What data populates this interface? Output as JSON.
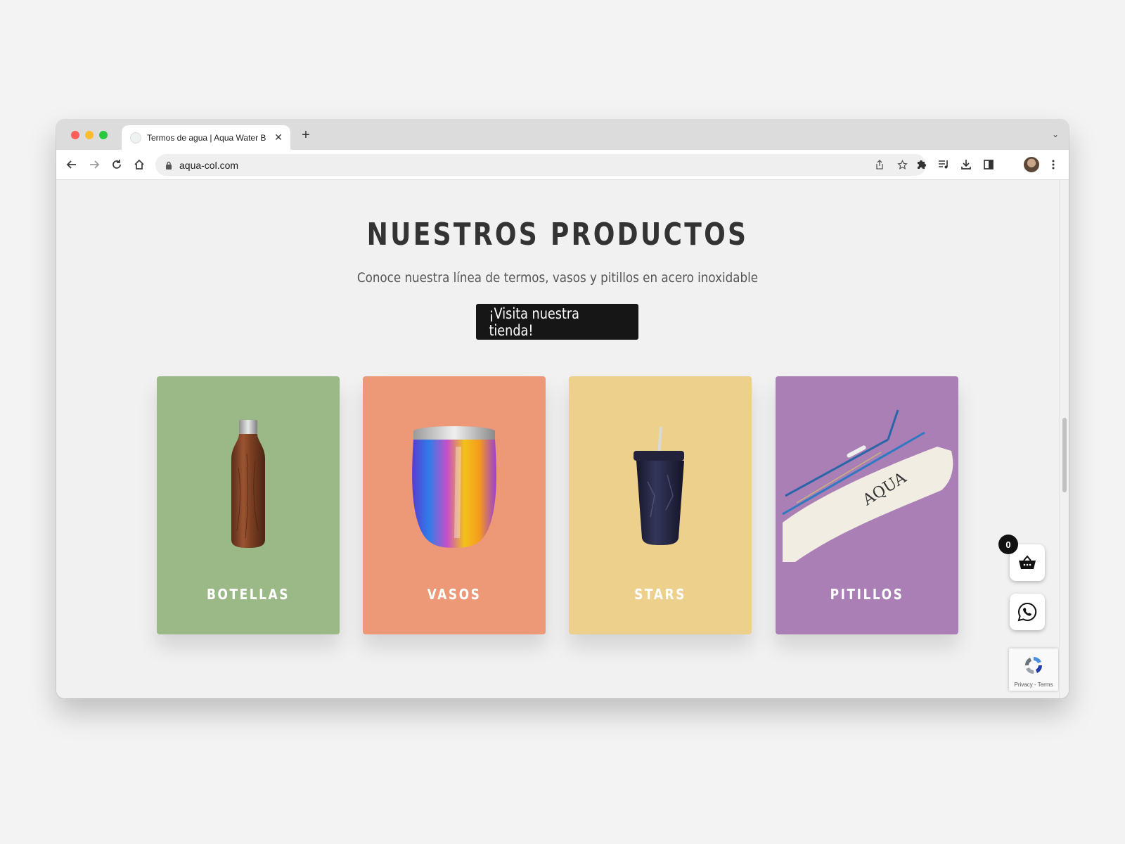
{
  "browser": {
    "tab_title": "Termos de agua | Aqua Water B",
    "url": "aqua-col.com",
    "tab_close": "✕",
    "new_tab": "+",
    "tab_list": "⌄"
  },
  "hero": {
    "title": "NUESTROS PRODUCTOS",
    "subtitle": "Conoce nuestra línea de termos, vasos y pitillos en acero inoxidable",
    "shop_button": "¡Visita nuestra tienda!"
  },
  "products": [
    {
      "label": "BOTELLAS",
      "color": "#9bb986"
    },
    {
      "label": "VASOS",
      "color": "#ed9877"
    },
    {
      "label": "STARS",
      "color": "#edd08b"
    },
    {
      "label": "PITILLOS",
      "color": "#a97fb5"
    }
  ],
  "cart": {
    "count": "0"
  },
  "recaptcha": {
    "text": "Privacy - Terms"
  },
  "icons": {
    "back": "arrow-left-icon",
    "forward": "arrow-right-icon",
    "reload": "reload-icon",
    "home": "home-icon",
    "lock": "lock-icon",
    "share": "share-icon",
    "star": "star-icon",
    "extensions": "puzzle-icon",
    "media": "media-control-icon",
    "download": "download-icon",
    "sidepanel": "side-panel-icon",
    "menu": "kebab-menu-icon",
    "cart": "basket-icon",
    "whatsapp": "whatsapp-icon"
  }
}
